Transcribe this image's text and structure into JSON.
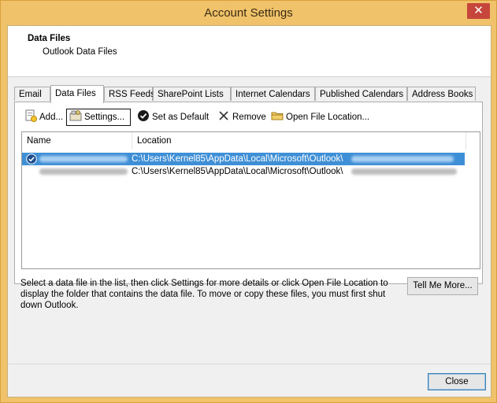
{
  "window": {
    "title": "Account Settings",
    "close_glyph": "✕"
  },
  "header": {
    "title": "Data Files",
    "subtitle": "Outlook Data Files"
  },
  "tabs": [
    {
      "label": "Email",
      "active": false
    },
    {
      "label": "Data Files",
      "active": true
    },
    {
      "label": "RSS Feeds",
      "active": false
    },
    {
      "label": "SharePoint Lists",
      "active": false
    },
    {
      "label": "Internet Calendars",
      "active": false
    },
    {
      "label": "Published Calendars",
      "active": false
    },
    {
      "label": "Address Books",
      "active": false
    }
  ],
  "toolbar": {
    "add": {
      "label": "Add...",
      "icon": "add-file-icon"
    },
    "settings": {
      "label": "Settings...",
      "icon": "settings-icon"
    },
    "set_default": {
      "label": "Set as Default",
      "icon": "check-circle-icon"
    },
    "remove": {
      "label": "Remove",
      "icon": "remove-x-icon"
    },
    "open_location": {
      "label": "Open File Location...",
      "icon": "folder-icon"
    }
  },
  "list": {
    "columns": [
      "Name",
      "Location"
    ],
    "rows": [
      {
        "name": "",
        "location": "C:\\Users\\Kernel85\\AppData\\Local\\Microsoft\\Outlook\\",
        "selected": true,
        "default": true
      },
      {
        "name": "",
        "location": "C:\\Users\\Kernel85\\AppData\\Local\\Microsoft\\Outlook\\",
        "selected": false,
        "default": false
      }
    ]
  },
  "info_text": "Select a data file in the list, then click Settings for more details or click Open File Location to display the folder that contains the data file. To move or copy these files, you must first shut down Outlook.",
  "buttons": {
    "tell_me_more": "Tell Me More...",
    "close": "Close"
  },
  "colors": {
    "frame": "#f0c36b",
    "selection": "#3f8fd6",
    "close_button": "#c7463b"
  }
}
